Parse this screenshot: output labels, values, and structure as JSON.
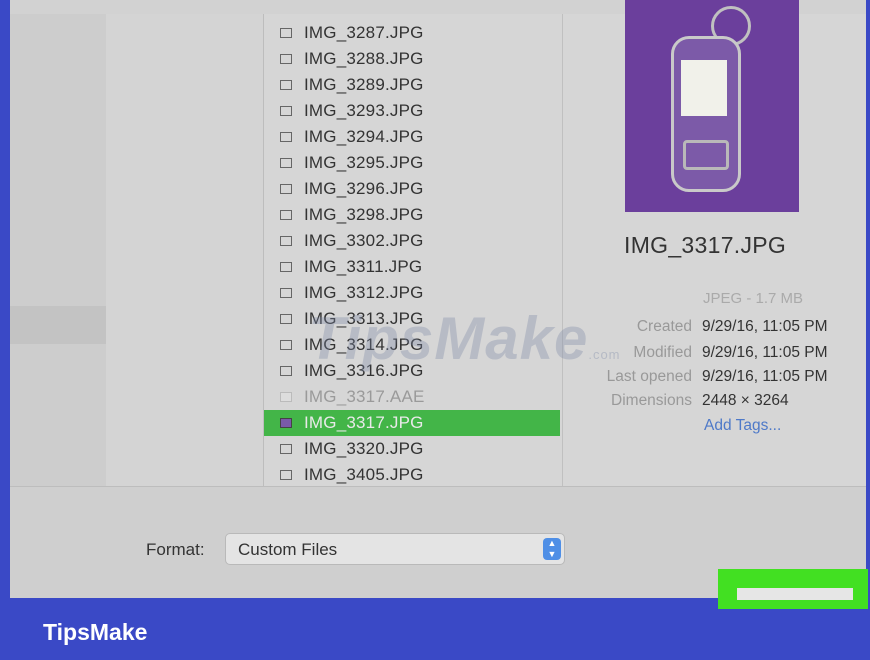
{
  "files": [
    {
      "name": "IMG_3287.JPG",
      "state": "normal"
    },
    {
      "name": "IMG_3288.JPG",
      "state": "normal"
    },
    {
      "name": "IMG_3289.JPG",
      "state": "normal"
    },
    {
      "name": "IMG_3293.JPG",
      "state": "normal"
    },
    {
      "name": "IMG_3294.JPG",
      "state": "normal"
    },
    {
      "name": "IMG_3295.JPG",
      "state": "normal"
    },
    {
      "name": "IMG_3296.JPG",
      "state": "normal"
    },
    {
      "name": "IMG_3298.JPG",
      "state": "normal"
    },
    {
      "name": "IMG_3302.JPG",
      "state": "normal"
    },
    {
      "name": "IMG_3311.JPG",
      "state": "normal"
    },
    {
      "name": "IMG_3312.JPG",
      "state": "normal"
    },
    {
      "name": "IMG_3313.JPG",
      "state": "normal"
    },
    {
      "name": "IMG_3314.JPG",
      "state": "normal"
    },
    {
      "name": "IMG_3316.JPG",
      "state": "normal"
    },
    {
      "name": "IMG_3317.AAE",
      "state": "dim"
    },
    {
      "name": "IMG_3317.JPG",
      "state": "selected"
    },
    {
      "name": "IMG_3320.JPG",
      "state": "normal"
    },
    {
      "name": "IMG_3405.JPG",
      "state": "normal"
    }
  ],
  "preview": {
    "file_name": "IMG_3317.JPG",
    "type_size": "JPEG - 1.7 MB",
    "created_label": "Created",
    "created_value": "9/29/16, 11:05 PM",
    "modified_label": "Modified",
    "modified_value": "9/29/16, 11:05 PM",
    "last_opened_label": "Last opened",
    "last_opened_value": "9/29/16, 11:05 PM",
    "dimensions_label": "Dimensions",
    "dimensions_value": "2448 × 3264",
    "add_tags": "Add Tags...",
    "thumbnail_icon": "photo-thumbnail"
  },
  "format": {
    "label": "Format:",
    "value": "Custom Files"
  },
  "watermark": {
    "text": "TipsMake",
    "suffix": ".com"
  },
  "brand": "TipsMake",
  "colors": {
    "selection_green": "#43b548",
    "highlight_green": "#42e022",
    "brand_blue": "#3a49c6",
    "link_blue": "#4e79c8"
  }
}
